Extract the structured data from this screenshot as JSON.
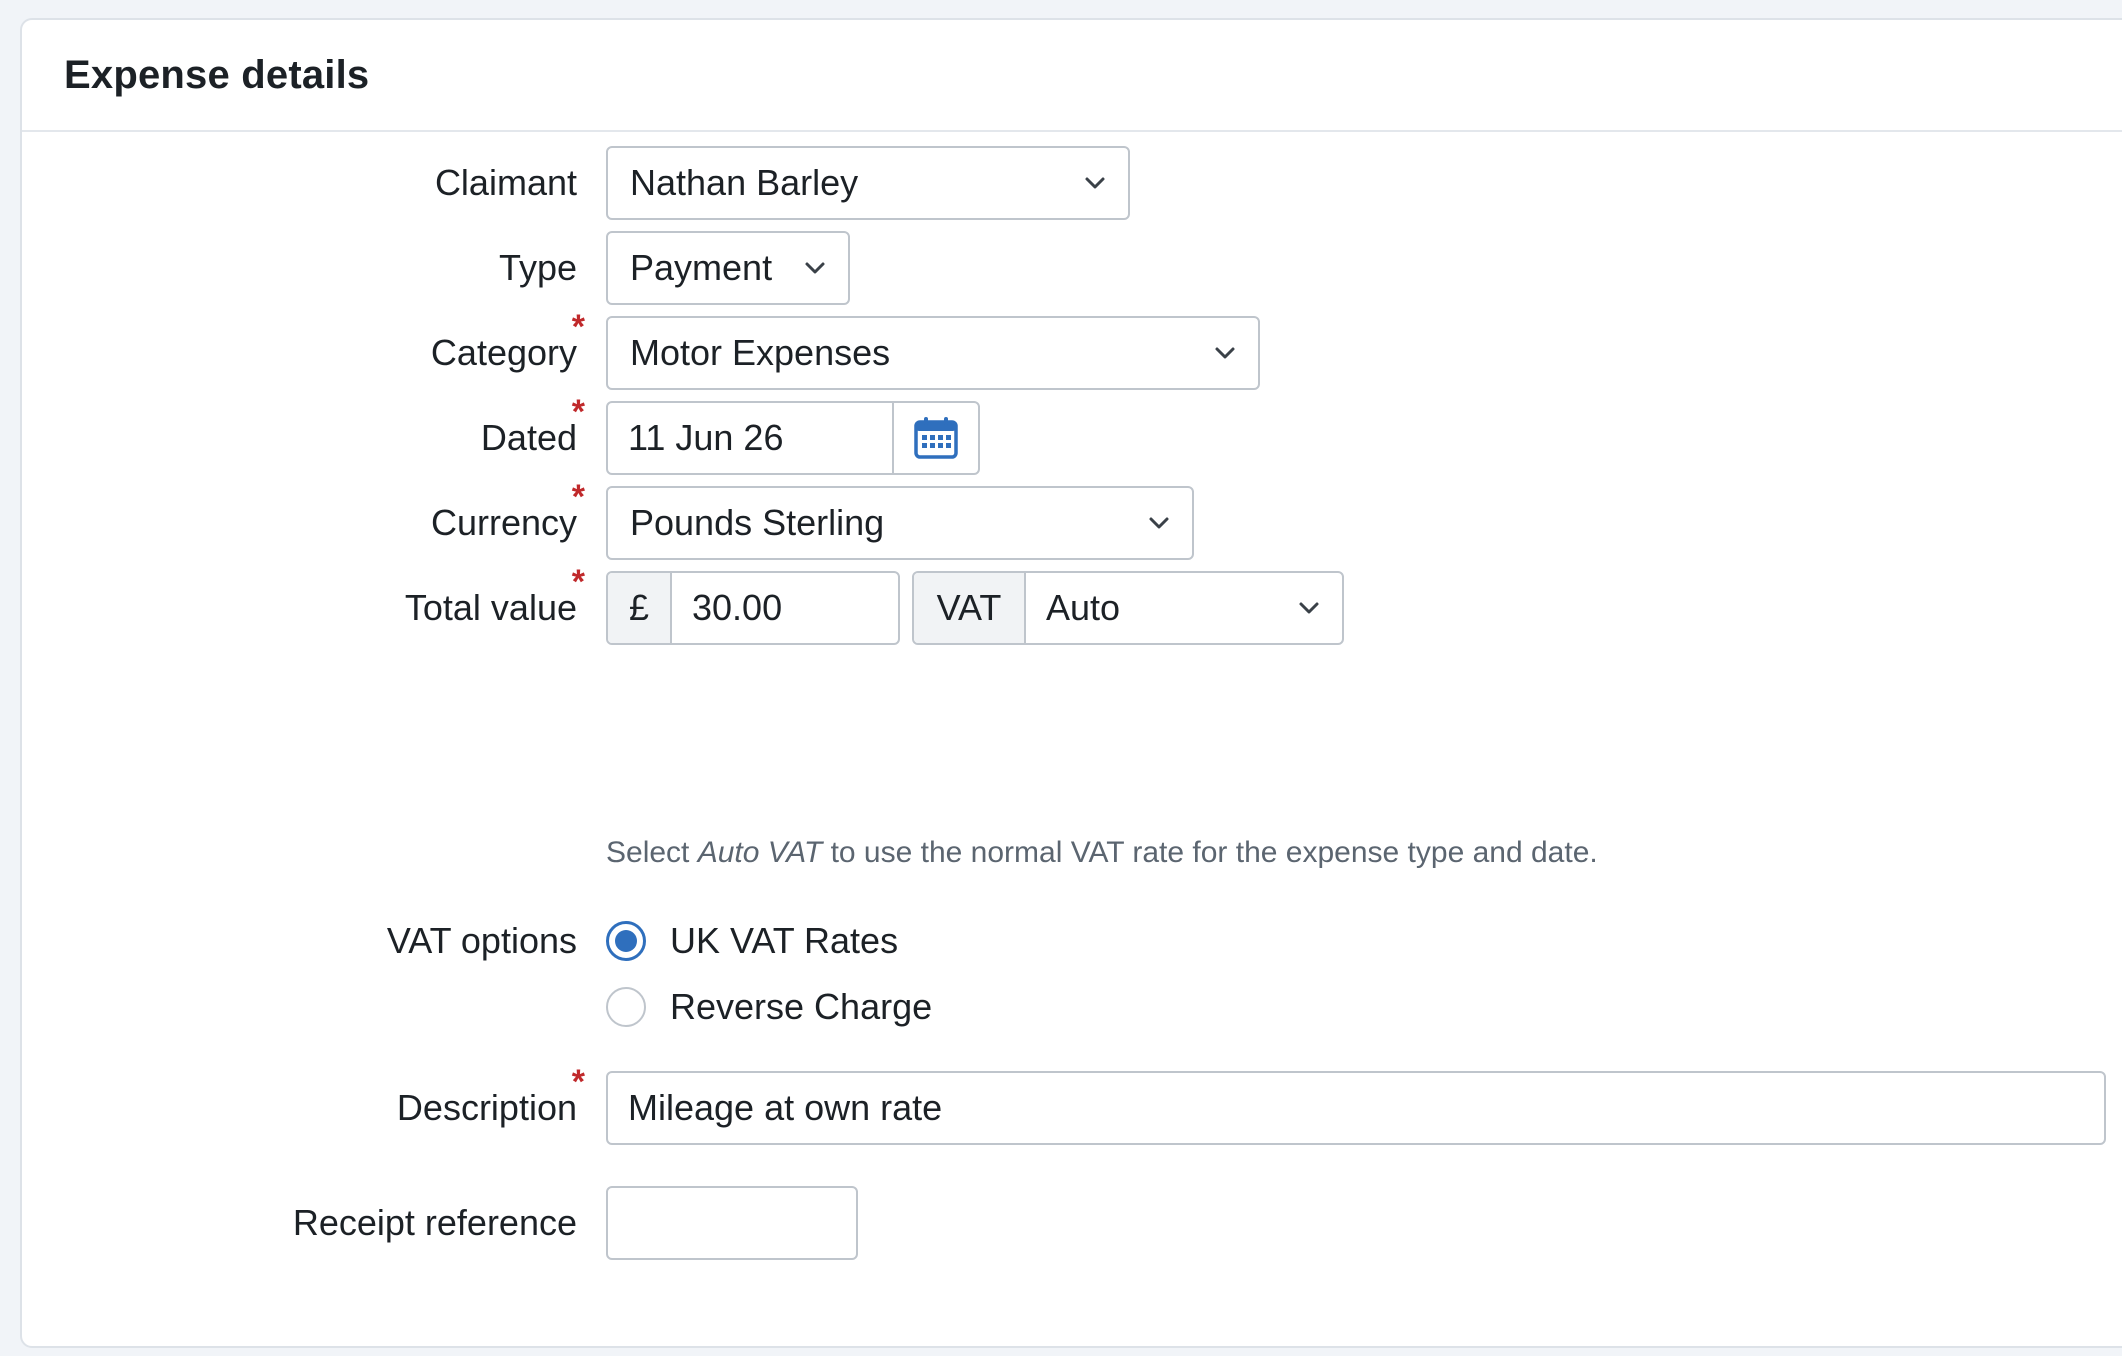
{
  "panel": {
    "title": "Expense details"
  },
  "form": {
    "claimant": {
      "label": "Claimant",
      "value": "Nathan Barley",
      "required": false
    },
    "type": {
      "label": "Type",
      "value": "Payment",
      "required": false
    },
    "category": {
      "label": "Category",
      "value": "Motor Expenses",
      "required": true
    },
    "dated": {
      "label": "Dated",
      "value": "11 Jun 26",
      "required": true
    },
    "currency": {
      "label": "Currency",
      "value": "Pounds Sterling",
      "required": true
    },
    "total_value": {
      "label": "Total value",
      "required": true,
      "currency_symbol": "£",
      "amount": "30.00",
      "vat_label": "VAT",
      "vat_value": "Auto",
      "help_prefix": "Select ",
      "help_em": "Auto VAT",
      "help_suffix": " to use the normal VAT rate for the expense type and date."
    },
    "vat_options": {
      "label": "VAT options",
      "options": [
        {
          "label": "UK VAT Rates",
          "selected": true
        },
        {
          "label": "Reverse Charge",
          "selected": false
        }
      ]
    },
    "description": {
      "label": "Description",
      "value": "Mileage at own rate",
      "required": true
    },
    "receipt_reference": {
      "label": "Receipt reference",
      "value": "",
      "required": false
    }
  },
  "required_marker": "*",
  "colors": {
    "accent": "#2f6fbd",
    "required": "#c0292b",
    "border": "#bfc5cc",
    "help_text": "#5b6570"
  },
  "icons": {
    "select_chevron": "chevron-down-icon",
    "date_picker": "calendar-icon"
  }
}
